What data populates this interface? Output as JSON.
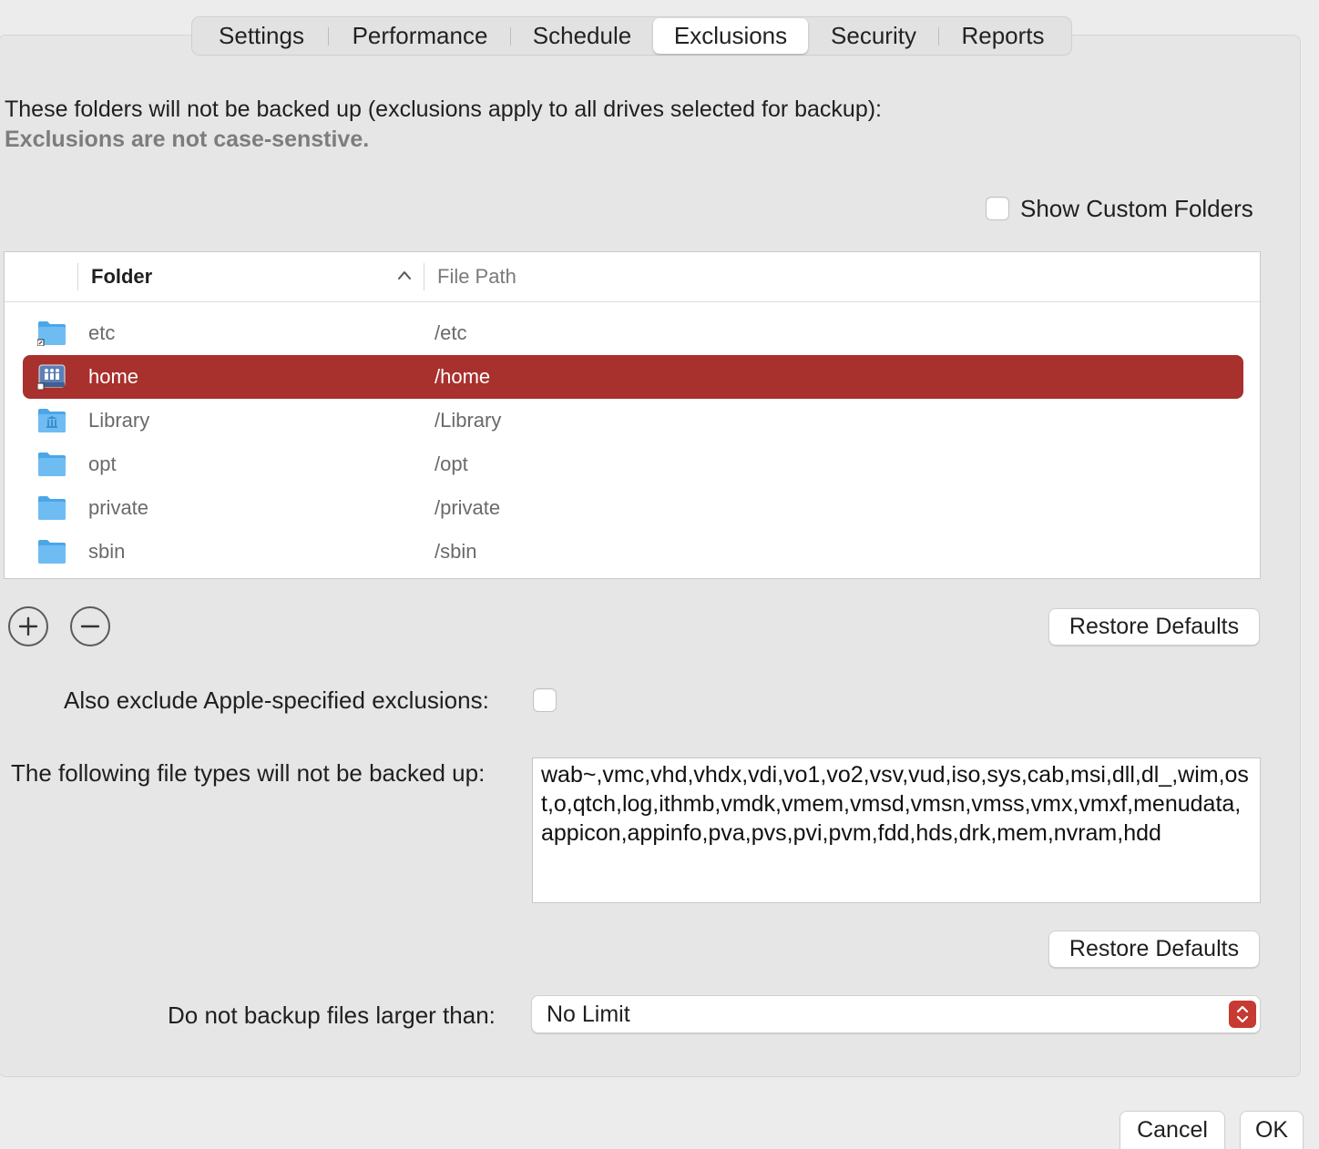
{
  "tabs": [
    "Settings",
    "Performance",
    "Schedule",
    "Exclusions",
    "Security",
    "Reports"
  ],
  "active_tab": "Exclusions",
  "description": {
    "line1": "These folders will not be backed up (exclusions apply to all drives selected for backup):",
    "line2": "Exclusions are not case-senstive."
  },
  "show_custom_folders": {
    "label": "Show Custom Folders",
    "checked": false
  },
  "table": {
    "columns": [
      "Folder",
      "File Path"
    ],
    "rows": [
      {
        "folder": "etc",
        "path": "/etc",
        "icon": "folder-alias-icon"
      },
      {
        "folder": "home",
        "path": "/home",
        "icon": "home-drive-icon",
        "selected": true
      },
      {
        "folder": "Library",
        "path": "/Library",
        "icon": "library-folder-icon"
      },
      {
        "folder": "opt",
        "path": "/opt",
        "icon": "folder-icon"
      },
      {
        "folder": "private",
        "path": "/private",
        "icon": "folder-icon"
      },
      {
        "folder": "sbin",
        "path": "/sbin",
        "icon": "folder-icon"
      }
    ]
  },
  "add_icon": "plus-icon",
  "remove_icon": "minus-icon",
  "restore_defaults_label": "Restore Defaults",
  "apple_exclusions": {
    "label": "Also exclude Apple-specified exclusions:",
    "checked": false
  },
  "file_types": {
    "label": "The following file types will not be backed up:",
    "value": "wab~,vmc,vhd,vhdx,vdi,vo1,vo2,vsv,vud,iso,sys,cab,msi,dll,dl_,wim,ost,o,qtch,log,ithmb,vmdk,vmem,vmsd,vmsn,vmss,vmx,vmxf,menudata,appicon,appinfo,pva,pvs,pvi,pvm,fdd,hds,drk,mem,nvram,hdd"
  },
  "size_limit": {
    "label": "Do not backup files larger than:",
    "value": "No Limit"
  },
  "footer": {
    "cancel_label": "Cancel",
    "ok_label": "OK"
  },
  "colors": {
    "accent": "#a8302d",
    "stepper": "#c63a32"
  }
}
